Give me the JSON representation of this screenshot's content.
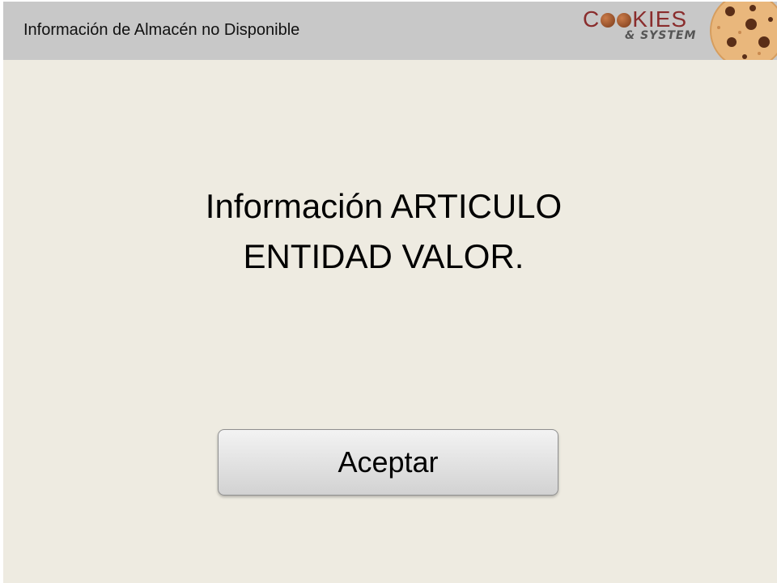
{
  "header": {
    "title": "Información de Almacén no Disponible",
    "logo": {
      "word": [
        "C",
        "KIES"
      ],
      "subtitle": "& SYSTEM",
      "brand_color": "#8a2d2d",
      "icon": "cookie-icon"
    }
  },
  "main": {
    "message_line_1": "Información ARTICULO",
    "message_line_2": "ENTIDAD VALOR."
  },
  "actions": {
    "accept_label": "Aceptar"
  },
  "colors": {
    "header_bg": "#c8c8c8",
    "body_bg": "#eeebe1"
  }
}
